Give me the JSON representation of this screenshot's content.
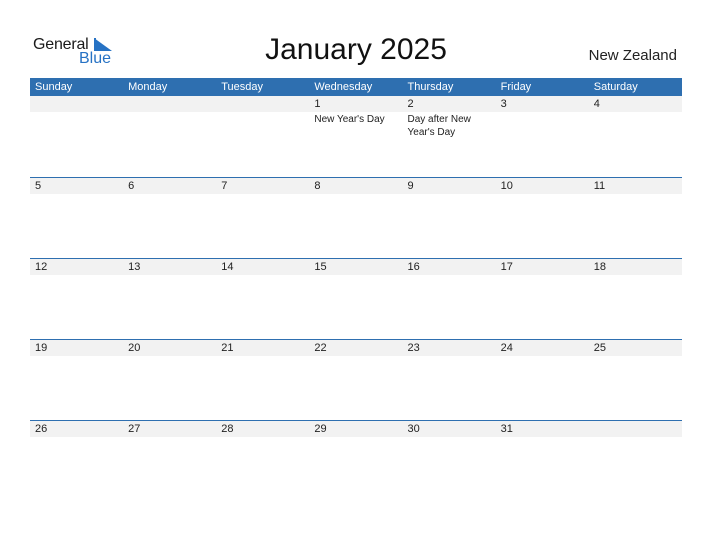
{
  "logo": {
    "general": "General",
    "blue": "Blue",
    "accent": "#2672c4"
  },
  "title": "January 2025",
  "country": "New Zealand",
  "colors": {
    "header_bg": "#2e6fb0",
    "daynum_bg": "#f2f2f2"
  },
  "weekdays": [
    "Sunday",
    "Monday",
    "Tuesday",
    "Wednesday",
    "Thursday",
    "Friday",
    "Saturday"
  ],
  "weeks": [
    {
      "days": [
        "",
        "",
        "",
        "1",
        "2",
        "3",
        "4"
      ],
      "events": [
        "",
        "",
        "",
        "New Year's Day",
        "Day after New Year's Day",
        "",
        ""
      ]
    },
    {
      "days": [
        "5",
        "6",
        "7",
        "8",
        "9",
        "10",
        "11"
      ],
      "events": [
        "",
        "",
        "",
        "",
        "",
        "",
        ""
      ]
    },
    {
      "days": [
        "12",
        "13",
        "14",
        "15",
        "16",
        "17",
        "18"
      ],
      "events": [
        "",
        "",
        "",
        "",
        "",
        "",
        ""
      ]
    },
    {
      "days": [
        "19",
        "20",
        "21",
        "22",
        "23",
        "24",
        "25"
      ],
      "events": [
        "",
        "",
        "",
        "",
        "",
        "",
        ""
      ]
    },
    {
      "days": [
        "26",
        "27",
        "28",
        "29",
        "30",
        "31",
        ""
      ],
      "events": [
        "",
        "",
        "",
        "",
        "",
        "",
        ""
      ]
    }
  ]
}
